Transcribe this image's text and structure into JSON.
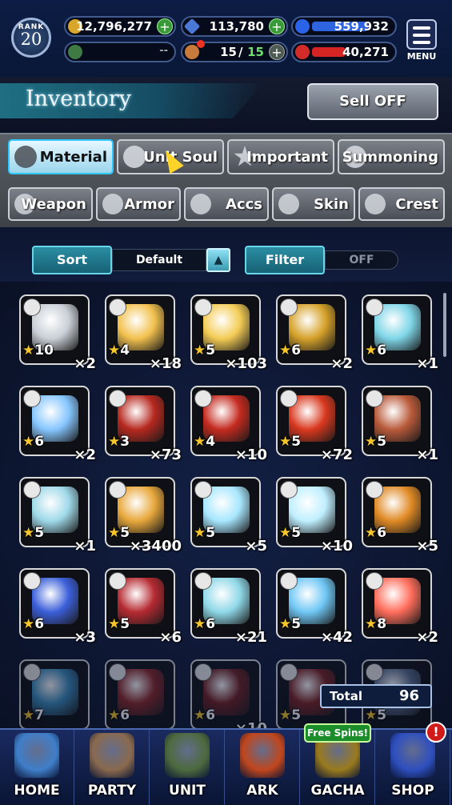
{
  "status": {
    "rank_label": "RANK",
    "rank": "20",
    "gil": "12,796,277",
    "lapis": "113,780",
    "blue_resource": "559,932",
    "stamina_slot": "--",
    "friend_points": "15",
    "friend_points_max": "15",
    "red_resource": "40,271",
    "menu_label": "MENU"
  },
  "header": {
    "title": "Inventory",
    "sell_button": "Sell OFF"
  },
  "tabs_row1": [
    "Material",
    "Unit Soul",
    "Important",
    "Summoning"
  ],
  "tabs_row2": [
    "Weapon",
    "Armor",
    "Accs",
    "Skin",
    "Crest"
  ],
  "sort": {
    "label": "Sort",
    "value": "Default",
    "direction_icon": "triangle-up-icon"
  },
  "filter": {
    "label": "Filter",
    "value": "OFF"
  },
  "items": [
    {
      "rarity": "10",
      "qty": "×2",
      "color": "#c9cfd6",
      "icon": "chest-icon"
    },
    {
      "rarity": "4",
      "qty": "×18",
      "color": "#f2c14e",
      "icon": "gold-bars-icon"
    },
    {
      "rarity": "5",
      "qty": "×103",
      "color": "#f4cc55",
      "icon": "gold-stack-icon"
    },
    {
      "rarity": "6",
      "qty": "×2",
      "color": "#d6a22a",
      "icon": "exp-flask-icon"
    },
    {
      "rarity": "6",
      "qty": "×1",
      "color": "#7fd6e8",
      "icon": "exp-flask-icon"
    },
    {
      "rarity": "6",
      "qty": "×2",
      "color": "#86c6ff",
      "icon": "rainbow-orb-icon"
    },
    {
      "rarity": "3",
      "qty": "×73",
      "color": "#b6281f",
      "icon": "red-potion-icon"
    },
    {
      "rarity": "4",
      "qty": "×10",
      "color": "#c42a1f",
      "icon": "red-potion-icon"
    },
    {
      "rarity": "5",
      "qty": "×72",
      "color": "#d9381e",
      "icon": "red-potion-icon"
    },
    {
      "rarity": "5",
      "qty": "×1",
      "color": "#b95a3a",
      "icon": "soul-crystal-icon"
    },
    {
      "rarity": "5",
      "qty": "×1",
      "color": "#9fd9e9",
      "icon": "soul-crystal-icon"
    },
    {
      "rarity": "5",
      "qty": "×3400",
      "color": "#e8a83c",
      "icon": "soul-crystal-icon"
    },
    {
      "rarity": "5",
      "qty": "×5",
      "color": "#a7e7ff",
      "icon": "gem-icon"
    },
    {
      "rarity": "5",
      "qty": "×10",
      "color": "#bfefff",
      "icon": "crystal-icon"
    },
    {
      "rarity": "6",
      "qty": "×5",
      "color": "#e08a25",
      "icon": "flame-icon"
    },
    {
      "rarity": "6",
      "qty": "×3",
      "color": "#3b5fd9",
      "icon": "shard-icon"
    },
    {
      "rarity": "5",
      "qty": "×6",
      "color": "#b52a32",
      "icon": "ruby-cluster-icon"
    },
    {
      "rarity": "6",
      "qty": "×21",
      "color": "#8fd8e8",
      "icon": "prism-icon"
    },
    {
      "rarity": "5",
      "qty": "×42",
      "color": "#6fc7f5",
      "icon": "prism-icon"
    },
    {
      "rarity": "8",
      "qty": "×2",
      "color": "#ff6d5b",
      "icon": "starburst-icon"
    },
    {
      "rarity": "7",
      "qty": "",
      "color": "#3a8bbd",
      "icon": "burst-icon"
    },
    {
      "rarity": "6",
      "qty": "",
      "color": "#8a2424",
      "icon": "card-icon"
    },
    {
      "rarity": "6",
      "qty": "×10",
      "color": "#6e1c1c",
      "icon": "card-icon"
    },
    {
      "rarity": "5",
      "qty": "",
      "color": "#7a1f1f",
      "icon": "card-icon"
    },
    {
      "rarity": "5",
      "qty": "",
      "color": "#5a6e90",
      "icon": "token-icon"
    }
  ],
  "total": {
    "label": "Total",
    "value": "96"
  },
  "nav": [
    {
      "label": "HOME",
      "color": "#3f7ec9"
    },
    {
      "label": "PARTY",
      "color": "#8a6a4e"
    },
    {
      "label": "UNIT",
      "color": "#4d6a3e"
    },
    {
      "label": "ARK",
      "color": "#c0461d"
    },
    {
      "label": "GACHA",
      "color": "#9a7a1e"
    },
    {
      "label": "SHOP",
      "color": "#2e4fbf"
    }
  ],
  "free_spins": "Free Spins!",
  "shop_alert": "!",
  "colors": {
    "accent": "#2dc8ff",
    "panel": "#0b1428",
    "nav": "#1a2a60"
  }
}
